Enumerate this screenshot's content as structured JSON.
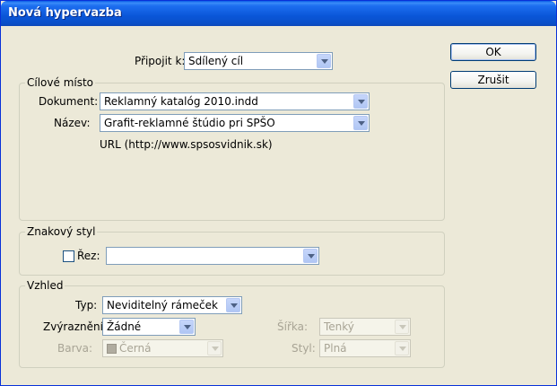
{
  "window": {
    "title": "Nová hypervazba"
  },
  "buttons": {
    "ok": "OK",
    "cancel": "Zrušit"
  },
  "connect": {
    "label": "Připojit k:",
    "value": "Sdílený cíl"
  },
  "target": {
    "legend": "Cílové místo",
    "document_label": "Dokument:",
    "document_value": "Reklamný katalóg 2010.indd",
    "name_label": "Název:",
    "name_value": "Grafit-reklamné štúdio pri SPŠO",
    "url": "URL (http://www.spsosvidnik.sk)"
  },
  "char_style": {
    "legend": "Znakový styl",
    "checkbox_label": "Řez:",
    "checked": false,
    "value": ""
  },
  "appearance": {
    "legend": "Vzhled",
    "type_label": "Typ:",
    "type_value": "Neviditelný rámeček",
    "highlight_label": "Zvýraznění:",
    "highlight_value": "Žádné",
    "width_label": "Šířka:",
    "width_value": "Tenký",
    "color_label": "Barva:",
    "color_value": "Černá",
    "style_label": "Styl:",
    "style_value": "Plná"
  }
}
